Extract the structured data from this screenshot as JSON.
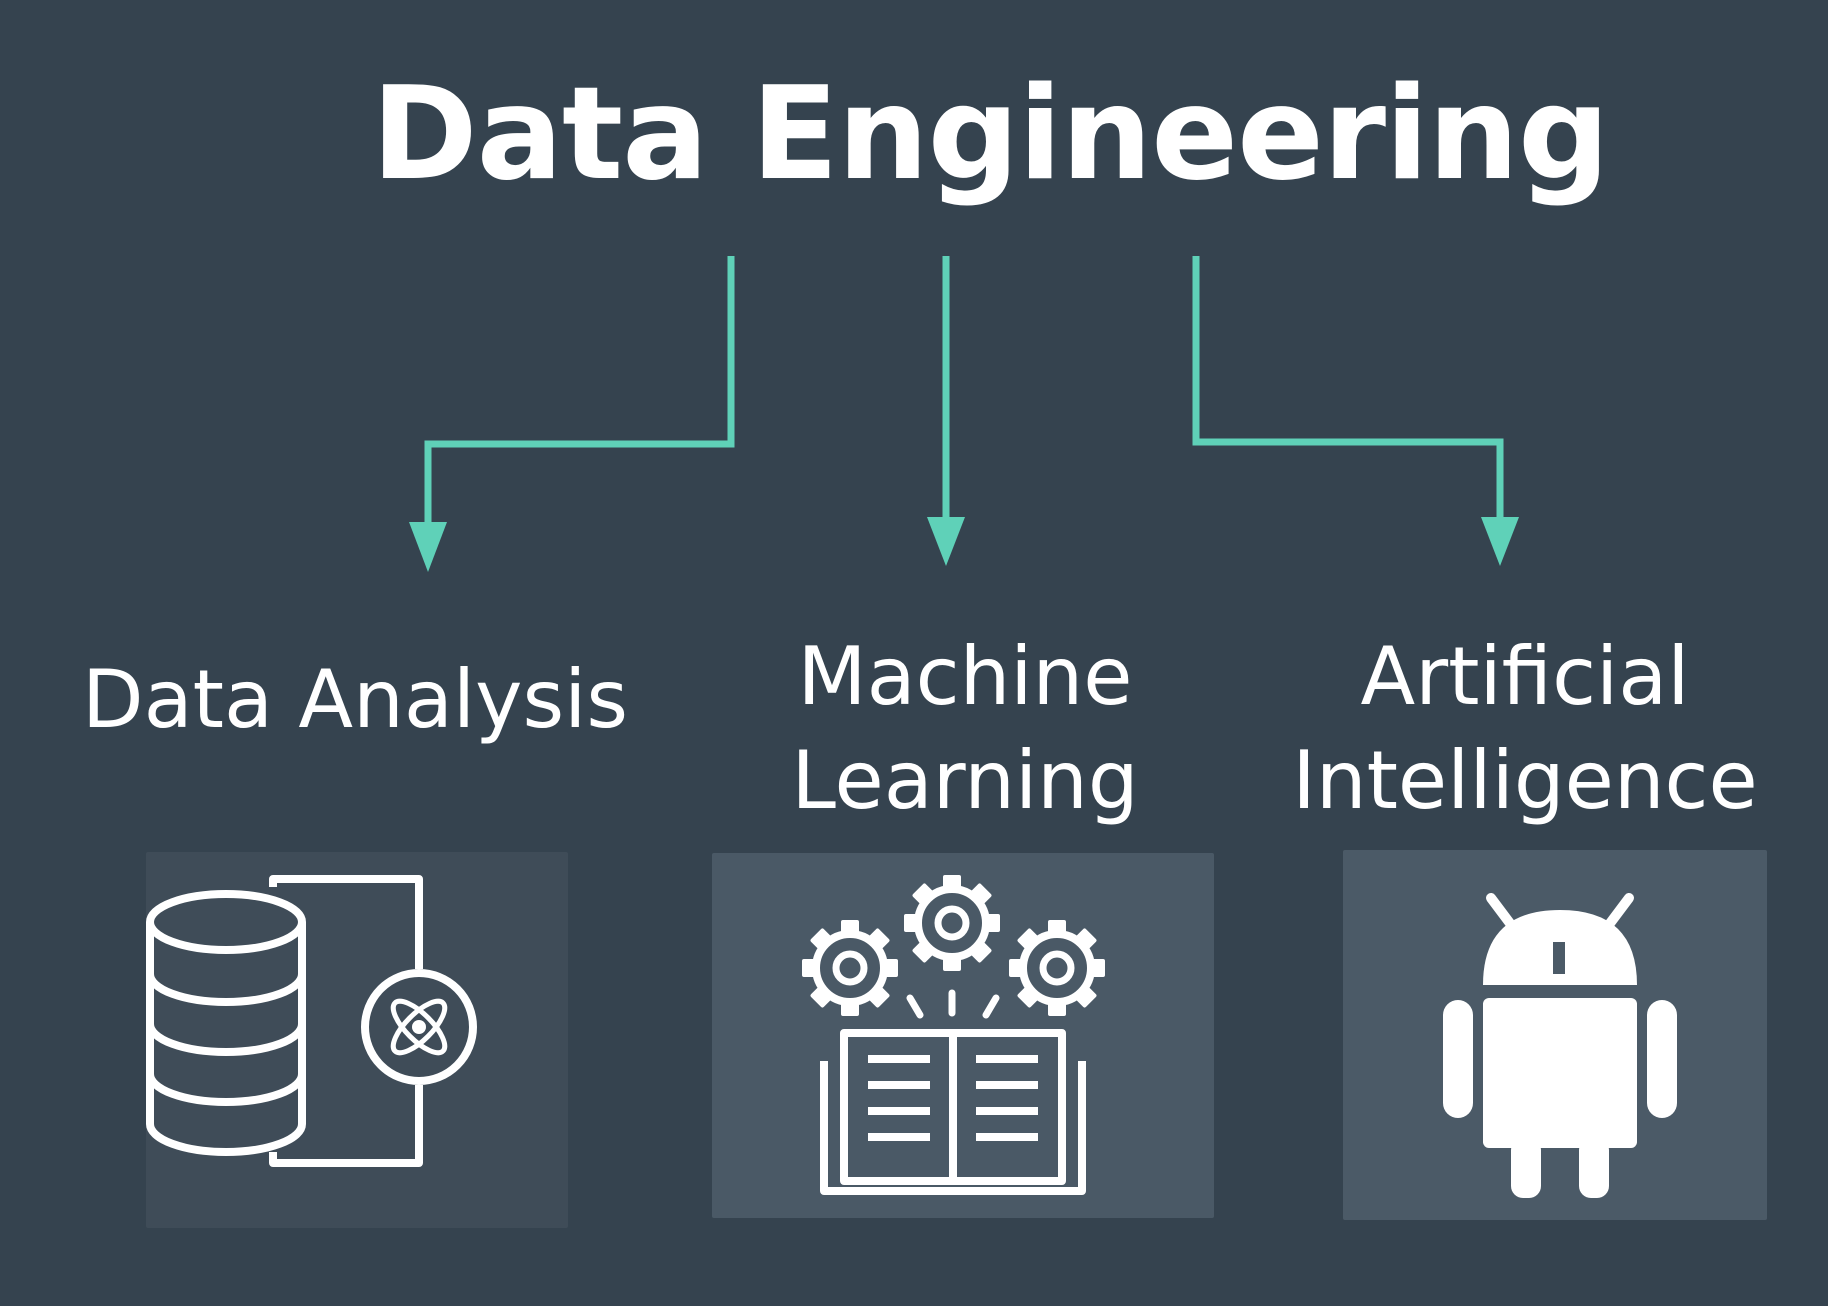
{
  "diagram": {
    "title": "Data Engineering",
    "branches": [
      {
        "id": "data-analysis",
        "label_lines": [
          "Data Analysis"
        ],
        "icon": "database-atom-icon"
      },
      {
        "id": "machine-learning",
        "label_lines": [
          "Machine",
          "Learning"
        ],
        "icon": "gears-book-icon"
      },
      {
        "id": "artificial-intelligence",
        "label_lines": [
          "Artificial",
          "Intelligence"
        ],
        "icon": "android-robot-icon"
      }
    ]
  },
  "colors": {
    "background": "#35434f",
    "arrow": "#5fd1b8",
    "text": "#ffffff",
    "card_da": "#3f4c58",
    "card_ml": "#4a5966",
    "card_ai": "#4b5a67"
  }
}
